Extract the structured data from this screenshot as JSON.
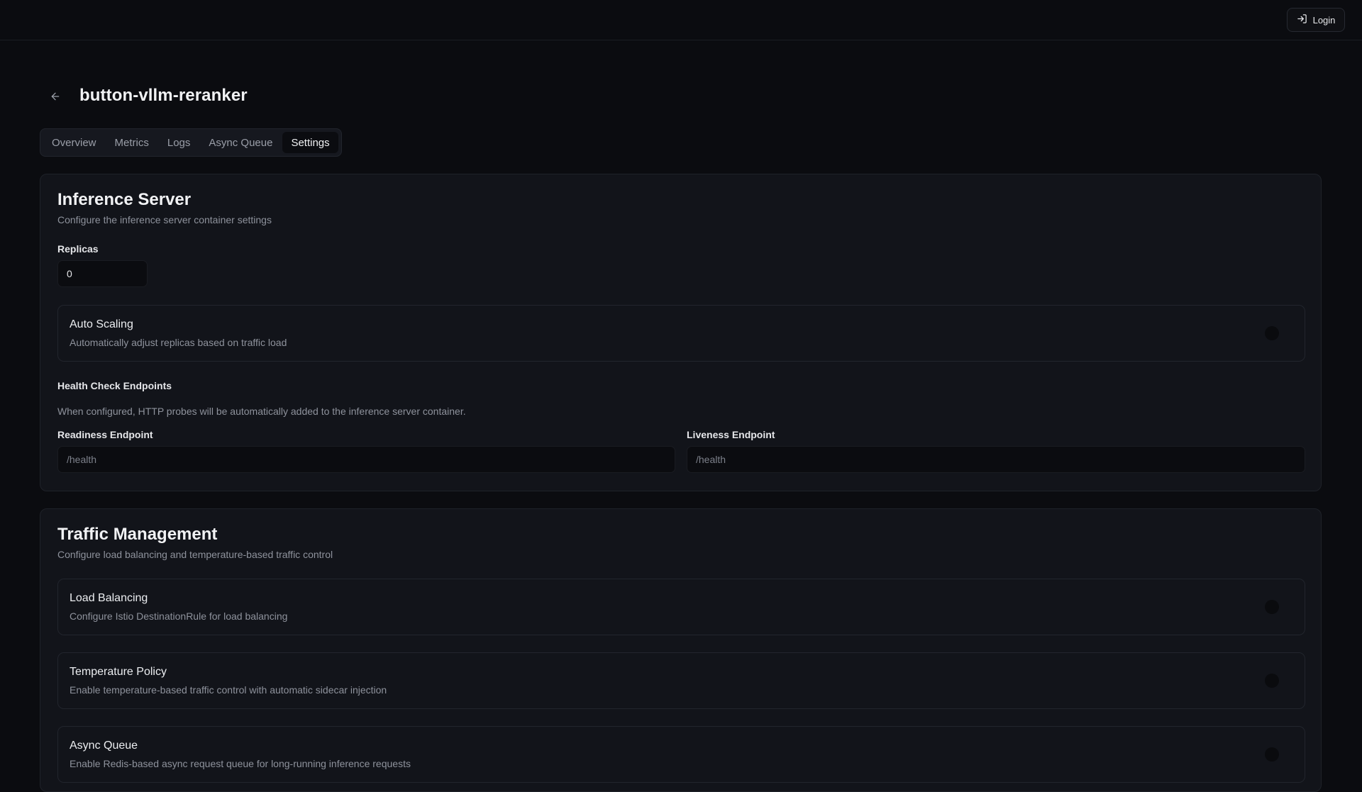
{
  "topbar": {
    "login_label": "Login",
    "login_icon": "log-in-icon"
  },
  "header": {
    "back_icon": "arrow-left-icon",
    "title": "button-vllm-reranker"
  },
  "tabs": [
    {
      "label": "Overview",
      "active": false
    },
    {
      "label": "Metrics",
      "active": false
    },
    {
      "label": "Logs",
      "active": false
    },
    {
      "label": "Async Queue",
      "active": false
    },
    {
      "label": "Settings",
      "active": true
    }
  ],
  "inference_server": {
    "title": "Inference Server",
    "description": "Configure the inference server container settings",
    "replicas_label": "Replicas",
    "replicas_value": "0",
    "auto_scaling": {
      "title": "Auto Scaling",
      "description": "Automatically adjust replicas based on traffic load",
      "enabled": false
    },
    "health_check": {
      "heading": "Health Check Endpoints",
      "note": "When configured, HTTP probes will be automatically added to the inference server container.",
      "readiness_label": "Readiness Endpoint",
      "readiness_placeholder": "/health",
      "liveness_label": "Liveness Endpoint",
      "liveness_placeholder": "/health"
    }
  },
  "traffic_management": {
    "title": "Traffic Management",
    "description": "Configure load balancing and temperature-based traffic control",
    "items": [
      {
        "title": "Load Balancing",
        "description": "Configure Istio DestinationRule for load balancing",
        "enabled": false
      },
      {
        "title": "Temperature Policy",
        "description": "Enable temperature-based traffic control with automatic sidecar injection",
        "enabled": false
      },
      {
        "title": "Async Queue",
        "description": "Enable Redis-based async request queue for long-running inference requests",
        "enabled": false
      }
    ]
  },
  "colors": {
    "background": "#0b0c10",
    "card": "#12141a",
    "border": "#22252d",
    "muted_text": "#8e929c"
  }
}
